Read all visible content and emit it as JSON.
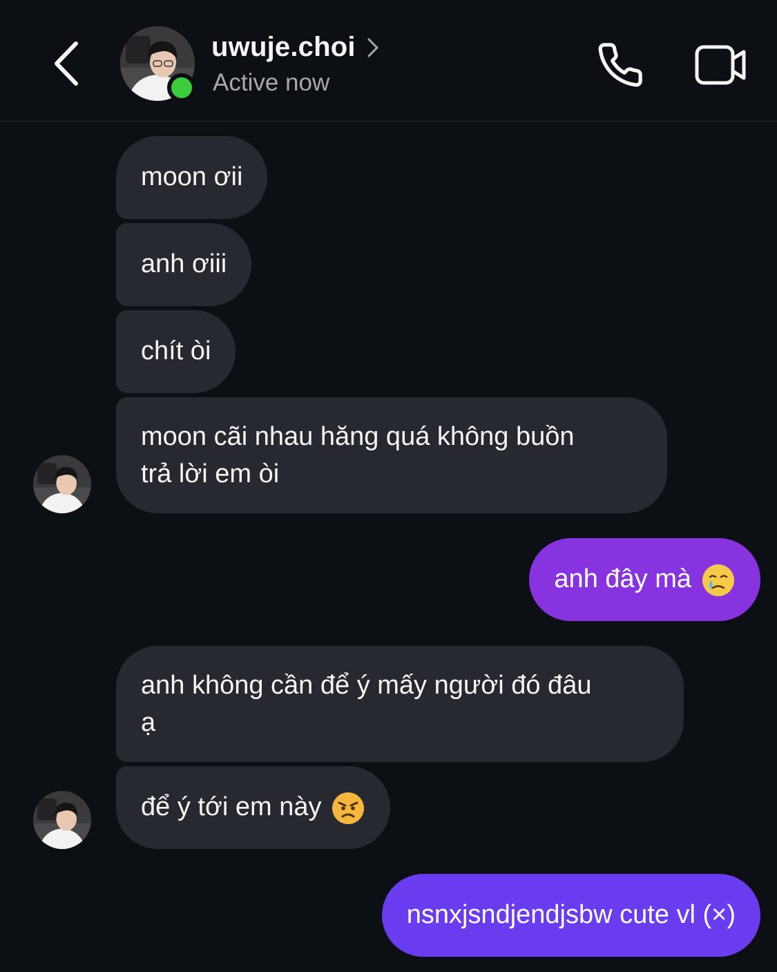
{
  "header": {
    "username": "uwuje.choi",
    "status": "Active now"
  },
  "colors": {
    "background": "#0c1014",
    "incoming_bubble": "#262a30",
    "outgoing_bubble_1": "#8734e0",
    "outgoing_bubble_2": "#6a3cf0",
    "online_dot": "#3ccc3c",
    "secondary_text": "#a8a8a8"
  },
  "messages": [
    {
      "direction": "incoming",
      "text": "moon ơii"
    },
    {
      "direction": "incoming",
      "text": "anh ơiii"
    },
    {
      "direction": "incoming",
      "text": "chít òi"
    },
    {
      "direction": "incoming",
      "line1": "moon cãi nhau hăng quá không buồn",
      "line2": "trả lời em òi"
    },
    {
      "direction": "outgoing",
      "text": "anh đây mà",
      "emoji": "crying-face-emoji"
    },
    {
      "direction": "incoming",
      "line1": "anh không cần để ý mấy người đó đâu",
      "line2": "ạ"
    },
    {
      "direction": "incoming",
      "text": "để ý tới em này",
      "emoji": "angry-face-emoji"
    },
    {
      "direction": "outgoing",
      "text": "nsnxjsndjendjsbw cute vl (×)"
    }
  ]
}
